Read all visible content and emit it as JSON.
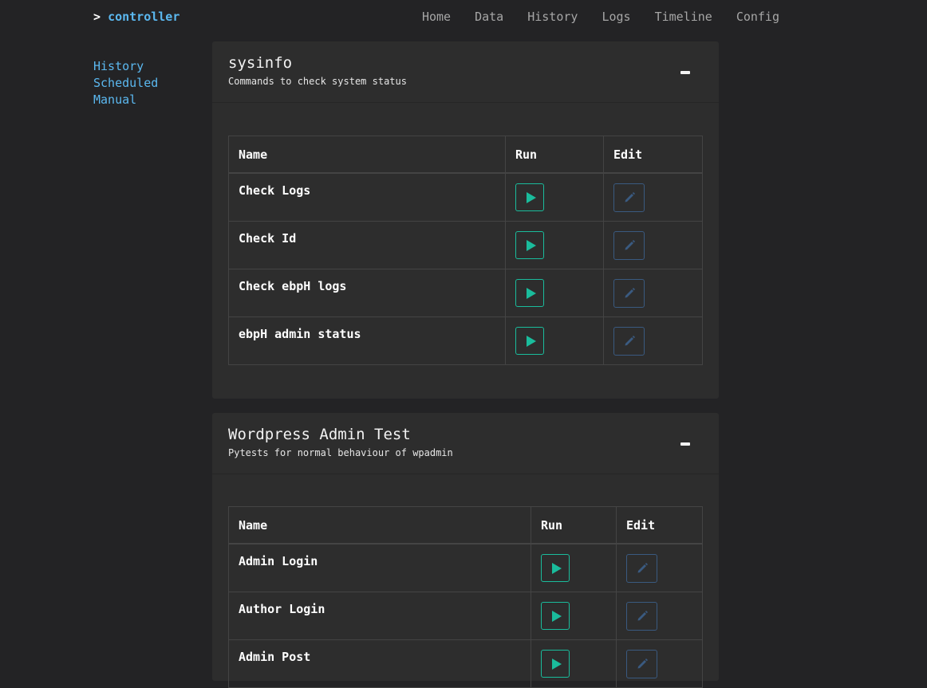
{
  "brand": {
    "prompt": ">",
    "name": "controller"
  },
  "nav": [
    "Home",
    "Data",
    "History",
    "Logs",
    "Timeline",
    "Config"
  ],
  "sidebar": [
    "History",
    "Scheduled",
    "Manual"
  ],
  "panels": [
    {
      "title": "sysinfo",
      "subtitle": "Commands to check system status",
      "headers": [
        "Name",
        "Run",
        "Edit"
      ],
      "rows": [
        "Check Logs",
        "Check Id",
        "Check ebpH logs",
        "ebpH admin status"
      ]
    },
    {
      "title": "Wordpress Admin Test",
      "subtitle": "Pytests for normal behaviour of wpadmin",
      "headers": [
        "Name",
        "Run",
        "Edit"
      ],
      "rows": [
        "Admin Login",
        "Author Login",
        "Admin Post"
      ]
    }
  ],
  "icons": {
    "run": "play-icon",
    "edit": "pencil-icon",
    "collapse": "minimize-icon"
  },
  "colors": {
    "accent": "#5bb8f0",
    "run": "#1abc9c",
    "edit": "#3a5a80",
    "background": "#232325",
    "panel": "#2d2d2d"
  }
}
